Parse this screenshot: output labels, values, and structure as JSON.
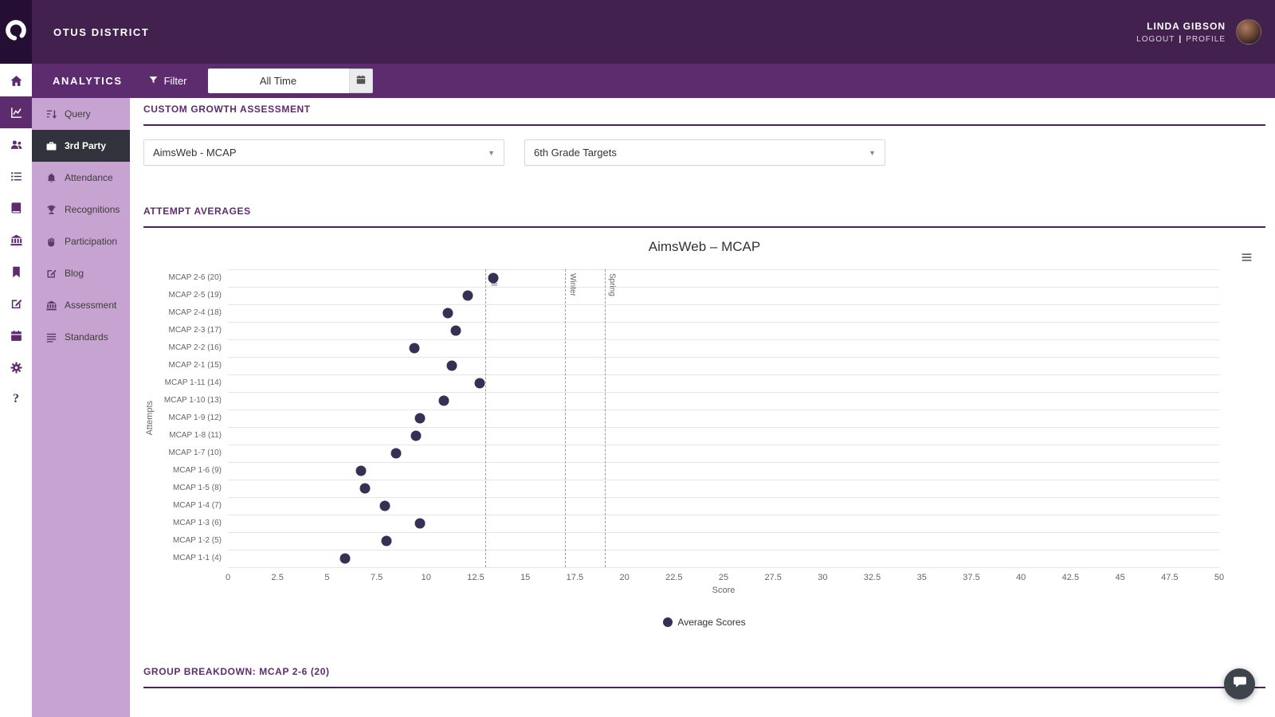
{
  "header": {
    "brand": "OTUS DISTRICT",
    "user_name": "LINDA GIBSON",
    "logout_label": "LOGOUT",
    "divider": "|",
    "profile_label": "PROFILE"
  },
  "analytics_bar": {
    "title": "ANALYTICS",
    "filter_label": "Filter",
    "date_range_value": "All Time"
  },
  "icon_rail": [
    {
      "icon": "home-icon",
      "active": false
    },
    {
      "icon": "analytics-icon",
      "active": true
    },
    {
      "icon": "people-icon",
      "active": false
    },
    {
      "icon": "list-icon",
      "active": false
    },
    {
      "icon": "book-icon",
      "active": false
    },
    {
      "icon": "bank-icon",
      "active": false
    },
    {
      "icon": "bookmark-icon",
      "active": false
    },
    {
      "icon": "compose-icon",
      "active": false
    },
    {
      "icon": "calendar-icon",
      "active": false
    },
    {
      "icon": "gear-icon",
      "active": false
    },
    {
      "icon": "question-icon",
      "active": false
    }
  ],
  "sidebar": [
    {
      "label": "Query",
      "icon": "sort-icon",
      "active": false
    },
    {
      "label": "3rd Party",
      "icon": "briefcase-icon",
      "active": true
    },
    {
      "label": "Attendance",
      "icon": "bell-icon",
      "active": false
    },
    {
      "label": "Recognitions",
      "icon": "trophy-icon",
      "active": false
    },
    {
      "label": "Participation",
      "icon": "hand-icon",
      "active": false
    },
    {
      "label": "Blog",
      "icon": "blog-icon",
      "active": false
    },
    {
      "label": "Assessment",
      "icon": "bank-icon",
      "active": false
    },
    {
      "label": "Standards",
      "icon": "list-lines-icon",
      "active": false
    }
  ],
  "main": {
    "section_custom_growth": "CUSTOM GROWTH ASSESSMENT",
    "assessment_dropdown_value": "AimsWeb - MCAP",
    "targets_dropdown_value": "6th Grade Targets",
    "section_attempt_averages": "ATTEMPT AVERAGES",
    "section_group_breakdown": "GROUP BREAKDOWN: MCAP 2-6 (20)"
  },
  "chart_data": {
    "type": "scatter",
    "title": "AimsWeb – MCAP",
    "xlabel": "Score",
    "ylabel": "Attempts",
    "xlim": [
      0,
      50
    ],
    "xtick_step": 2.5,
    "grid": true,
    "legend": [
      "Average Scores"
    ],
    "legend_position": "bottom",
    "point_color": "#343156",
    "categories": [
      "MCAP 2-6 (20)",
      "MCAP 2-5 (19)",
      "MCAP 2-4 (18)",
      "MCAP 2-3 (17)",
      "MCAP 2-2 (16)",
      "MCAP 2-1 (15)",
      "MCAP 1-11 (14)",
      "MCAP 1-10 (13)",
      "MCAP 1-9 (12)",
      "MCAP 1-8 (11)",
      "MCAP 1-7 (10)",
      "MCAP 1-6 (9)",
      "MCAP 1-5 (8)",
      "MCAP 1-4 (7)",
      "MCAP 1-3 (6)",
      "MCAP 1-2 (5)",
      "MCAP 1-1 (4)"
    ],
    "values": [
      13.4,
      12.1,
      11.1,
      11.5,
      9.4,
      11.3,
      12.7,
      10.9,
      9.7,
      9.5,
      8.5,
      6.7,
      6.9,
      7.9,
      9.7,
      8.0,
      5.9
    ],
    "plot_lines": [
      {
        "label": "Fall",
        "value": 13
      },
      {
        "label": "Winter",
        "value": 17
      },
      {
        "label": "Spring",
        "value": 19
      }
    ]
  }
}
